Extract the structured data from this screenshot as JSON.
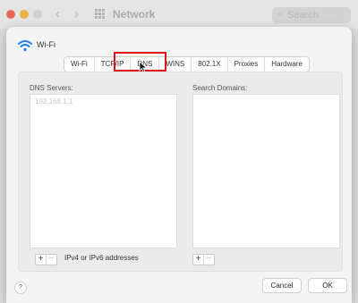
{
  "window": {
    "title": "Network",
    "search_placeholder": "Search"
  },
  "sheet": {
    "interface_name": "Wi-Fi",
    "tabs": [
      "Wi-Fi",
      "TCP/IP",
      "DNS",
      "WINS",
      "802.1X",
      "Proxies",
      "Hardware"
    ],
    "selected_tab": "DNS"
  },
  "dns": {
    "label": "DNS Servers:",
    "entries": [
      "192.168.1.1"
    ],
    "hint": "IPv4 or IPv6 addresses"
  },
  "search_domains": {
    "label": "Search Domains:"
  },
  "buttons": {
    "add": "+",
    "remove": "−",
    "help": "?",
    "cancel": "Cancel",
    "ok": "OK"
  },
  "colors": {
    "highlight": "#e0161d",
    "wifi_blue": "#1e7cf0"
  }
}
